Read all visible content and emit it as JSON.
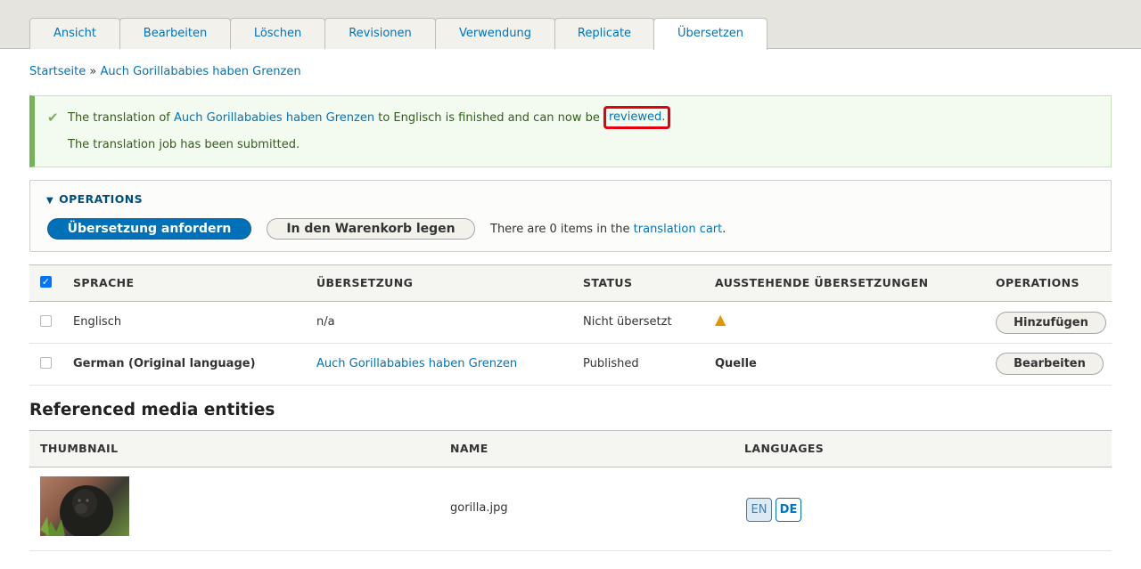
{
  "tabs": [
    {
      "label": "Ansicht"
    },
    {
      "label": "Bearbeiten"
    },
    {
      "label": "Löschen"
    },
    {
      "label": "Revisionen"
    },
    {
      "label": "Verwendung"
    },
    {
      "label": "Replicate"
    },
    {
      "label": "Übersetzen",
      "active": true
    }
  ],
  "breadcrumb": {
    "home": "Startseite",
    "separator": "»",
    "current": "Auch Gorillababies haben Grenzen"
  },
  "message": {
    "before": "The translation of ",
    "link": "Auch Gorillababies haben Grenzen",
    "middle": " to Englisch is finished and can now be ",
    "reviewed_link": "reviewed",
    "after": ".",
    "line2": "The translation job has been submitted."
  },
  "operations": {
    "summary": "OPERATIONS",
    "request_button": "Übersetzung anfordern",
    "cart_button": "In den Warenkorb legen",
    "cart_text_before": "There are 0 items in the ",
    "cart_link": "translation cart",
    "cart_text_after": "."
  },
  "translations_table": {
    "headers": {
      "language": "SPRACHE",
      "translation": "ÜBERSETZUNG",
      "status": "STATUS",
      "pending": "AUSSTEHENDE ÜBERSETZUNGEN",
      "operations": "OPERATIONS"
    },
    "rows": [
      {
        "language": "Englisch",
        "translation": "n/a",
        "status": "Nicht übersetzt",
        "pending": "",
        "operation": "Hinzufügen"
      },
      {
        "language": "German (Original language)",
        "translation": "Auch Gorillababies haben Grenzen",
        "status": "Published",
        "pending": "Quelle",
        "operation": "Bearbeiten"
      }
    ]
  },
  "media": {
    "heading": "Referenced media entities",
    "headers": {
      "thumbnail": "THUMBNAIL",
      "name": "NAME",
      "languages": "LANGUAGES"
    },
    "rows": [
      {
        "name": "gorilla.jpg",
        "languages": [
          "EN",
          "DE"
        ]
      }
    ]
  },
  "colors": {
    "link": "#0074bd",
    "primary_button": "#0071b8",
    "success_border": "#77b259",
    "highlight": "#e3000f",
    "warning": "#e09600"
  },
  "icons": {
    "message": "check-icon",
    "pending": "warning-icon",
    "summary": "triangle-down-icon"
  }
}
